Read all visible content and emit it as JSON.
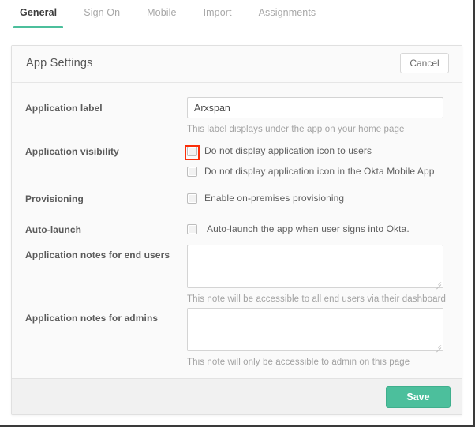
{
  "tabs": [
    {
      "label": "General",
      "active": true
    },
    {
      "label": "Sign On",
      "active": false
    },
    {
      "label": "Mobile",
      "active": false
    },
    {
      "label": "Import",
      "active": false
    },
    {
      "label": "Assignments",
      "active": false
    }
  ],
  "card": {
    "title": "App Settings",
    "cancel_label": "Cancel",
    "save_label": "Save"
  },
  "form": {
    "application_label": {
      "label": "Application label",
      "value": "Arxspan",
      "placeholder": "",
      "hint": "This label displays under the app on your home page"
    },
    "application_visibility": {
      "label": "Application visibility",
      "option_users": "Do not display application icon to users",
      "option_mobile": "Do not display application icon in the Okta Mobile App"
    },
    "provisioning": {
      "label": "Provisioning",
      "option_enable": "Enable on-premises provisioning"
    },
    "auto_launch": {
      "label": "Auto-launch",
      "option_autolaunch": "Auto-launch the app when user signs into Okta."
    },
    "notes_end_users": {
      "label": "Application notes for end users",
      "value": "",
      "placeholder": "",
      "hint": "This note will be accessible to all end users via their dashboard"
    },
    "notes_admins": {
      "label": "Application notes for admins",
      "value": "",
      "placeholder": "",
      "hint": "This note will only be accessible to admin on this page"
    }
  },
  "colors": {
    "accent": "#4cbf9c",
    "annotation": "#fb2e08",
    "card_bg": "#fafafa",
    "footer_bg": "#f1f1f1"
  }
}
